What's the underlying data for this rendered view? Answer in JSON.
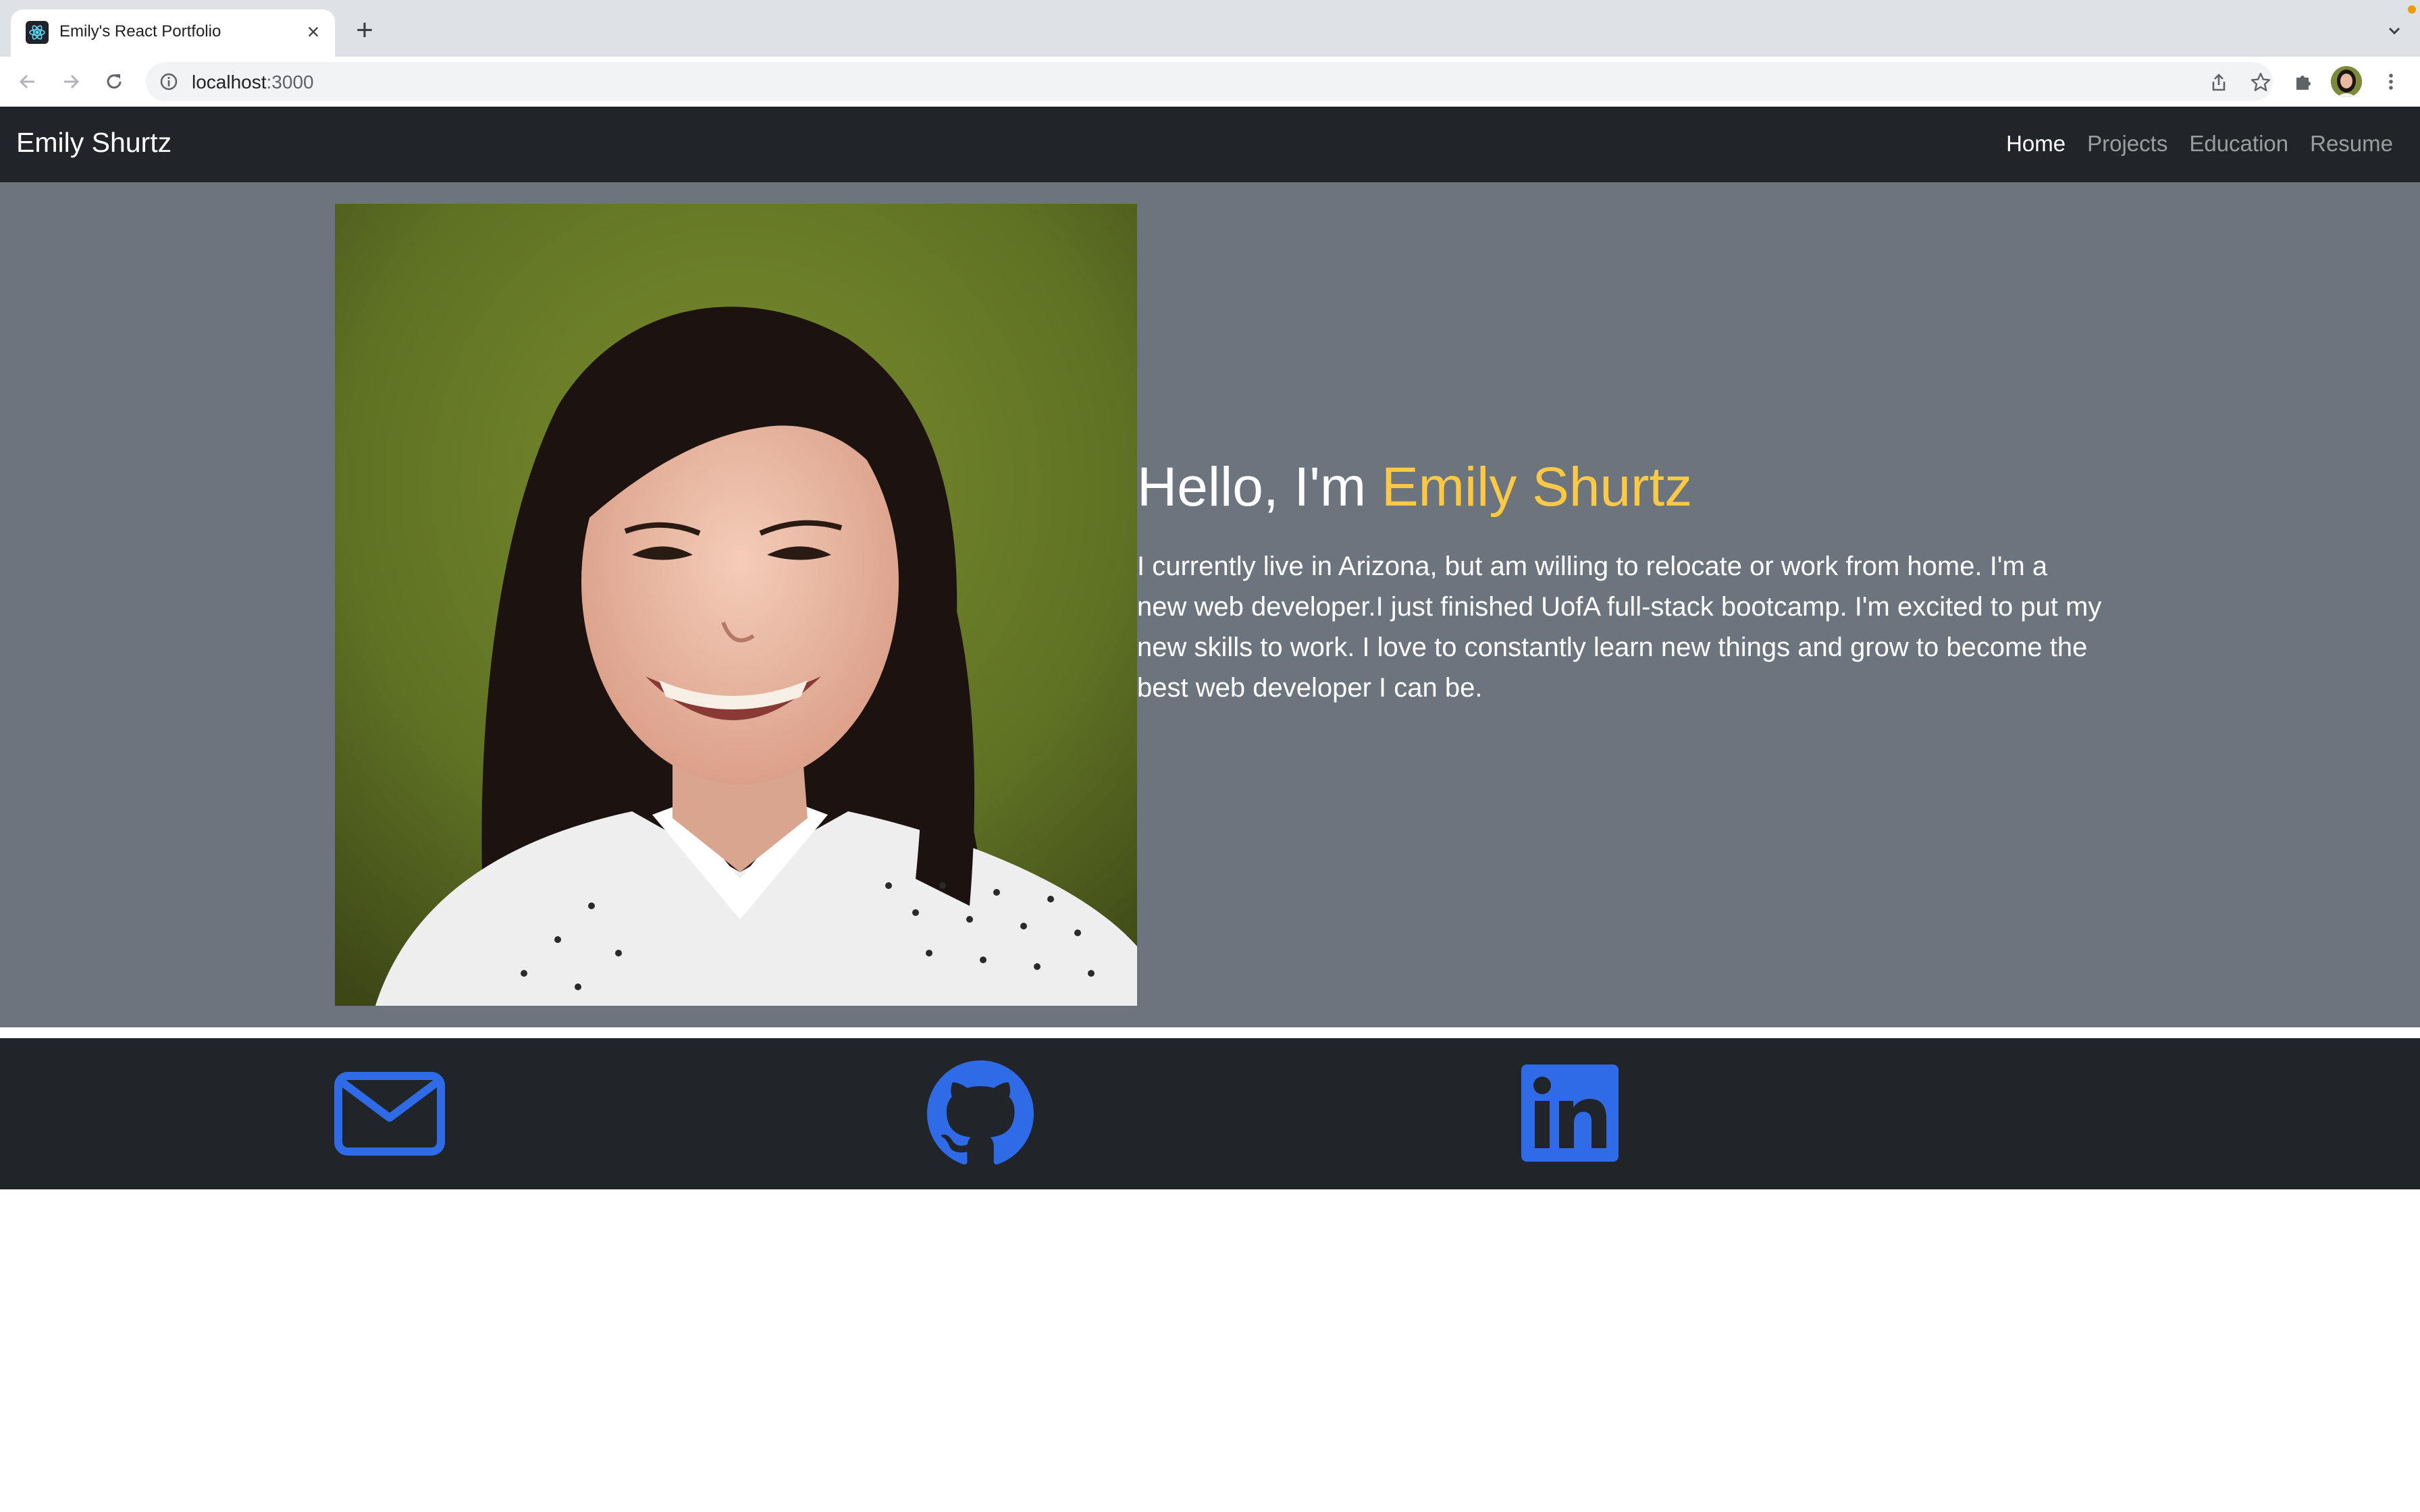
{
  "browser": {
    "tab_title": "Emily's React Portfolio",
    "tab_close": "×",
    "new_tab": "+",
    "url_host": "localhost",
    "url_port": ":3000",
    "icons": [
      "react-favicon-icon",
      "back-arrow-icon",
      "forward-arrow-icon",
      "reload-icon",
      "site-info-icon",
      "share-icon",
      "bookmark-star-icon",
      "extensions-puzzle-icon",
      "profile-avatar",
      "more-menu-icon",
      "tab-search-icon"
    ]
  },
  "navbar": {
    "brand": "Emily Shurtz",
    "links": [
      {
        "label": "Home",
        "active": true
      },
      {
        "label": "Projects",
        "active": false
      },
      {
        "label": "Education",
        "active": false
      },
      {
        "label": "Resume",
        "active": false
      }
    ]
  },
  "hero": {
    "greeting_prefix": "Hello, I'm ",
    "greeting_name": "Emily Shurtz",
    "bio": "I currently live in Arizona, but am willing to relocate or work from home. I'm a new web developer.I just finished UofA full-stack bootcamp. I'm excited to put my new skills to work. I love to constantly learn new things and grow to become the best web developer I can be.",
    "photo": "profile-photo"
  },
  "footer": {
    "icons": [
      "email-icon",
      "github-icon",
      "linkedin-icon"
    ]
  },
  "colors": {
    "navbar_bg": "#212529",
    "hero_bg": "#6c757d",
    "accent_name": "#ffc845",
    "social_icon": "#2f6be6",
    "nav_inactive": "rgba(255,255,255,0.55)"
  }
}
